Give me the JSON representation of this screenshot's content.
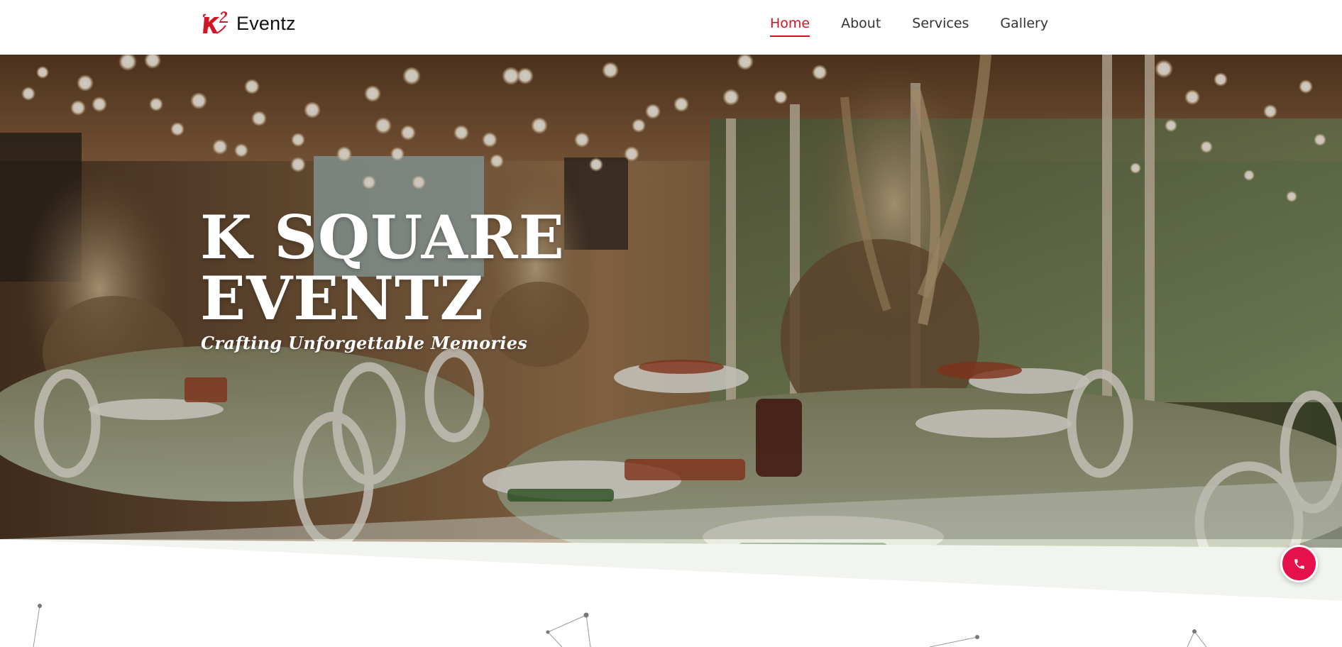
{
  "brand": {
    "name": "Eventz",
    "logo_icon": "k-squared-logo",
    "accent_color": "#d11523"
  },
  "nav": {
    "items": [
      {
        "label": "Home",
        "active": true
      },
      {
        "label": "About",
        "active": false
      },
      {
        "label": "Services",
        "active": false
      },
      {
        "label": "Gallery",
        "active": false
      }
    ]
  },
  "hero": {
    "title_line1": "K SQUARE",
    "title_line2": "EVENTZ",
    "subtitle": "Crafting Unforgettable Memories",
    "background_image": "banquet-hall-photo"
  },
  "call_button": {
    "icon": "phone-icon",
    "color": "#e5104c"
  }
}
